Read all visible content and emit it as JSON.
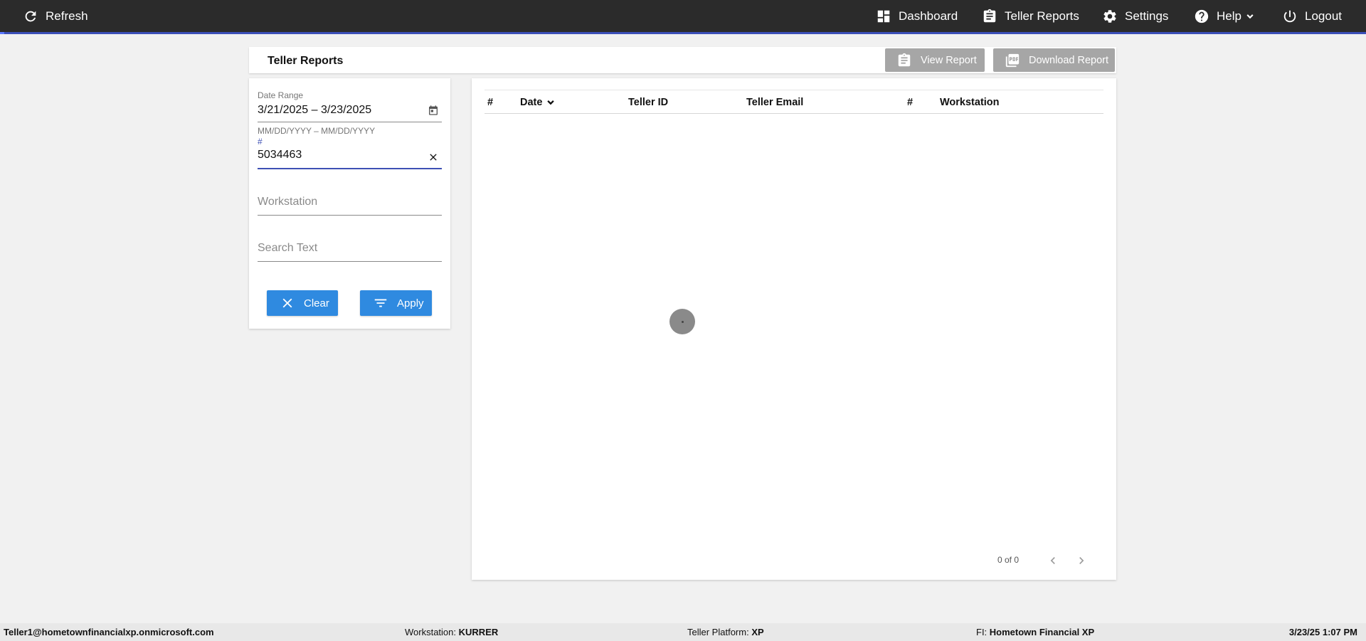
{
  "topbar": {
    "refresh_label": "Refresh",
    "nav": {
      "dashboard": "Dashboard",
      "teller_reports": "Teller Reports",
      "settings": "Settings",
      "help": "Help",
      "logout": "Logout"
    },
    "icons": {
      "refresh": "refresh-icon",
      "dashboard": "dashboard-icon",
      "teller_reports": "clipboard-icon",
      "settings": "gear-icon",
      "help": "help-circle-icon",
      "help_menu": "chevron-down-icon",
      "logout": "power-icon"
    }
  },
  "header": {
    "title": "Teller Reports",
    "view_report_label": "View Report",
    "download_report_label": "Download Report"
  },
  "filters": {
    "date_range": {
      "label": "Date Range",
      "value": "3/21/2025 – 3/23/2025",
      "hint": "MM/DD/YYYY – MM/DD/YYYY"
    },
    "number": {
      "label": "#",
      "value": "5034463"
    },
    "workstation": {
      "placeholder": "Workstation"
    },
    "search_text": {
      "placeholder": "Search Text"
    },
    "clear_label": "Clear",
    "apply_label": "Apply"
  },
  "table": {
    "columns": [
      "#",
      "Date",
      "Teller ID",
      "Teller Email",
      "#",
      "Workstation"
    ],
    "rows": [],
    "pager": "0 of 0"
  },
  "footer": {
    "user": "Teller1@hometownfinancialxp.onmicrosoft.com",
    "workstation_label": "Workstation:",
    "workstation_value": "KURRER",
    "platform_label": "Teller Platform:",
    "platform_value": "XP",
    "fi_label": "FI:",
    "fi_value": "Hometown Financial XP",
    "datetime": "3/23/25 1:07 PM"
  },
  "colors": {
    "topbar_bg": "#2b2b2b",
    "accent": "#3e50b4",
    "button_blue": "#2f8ae0",
    "button_disabled": "#a6a6a6"
  }
}
